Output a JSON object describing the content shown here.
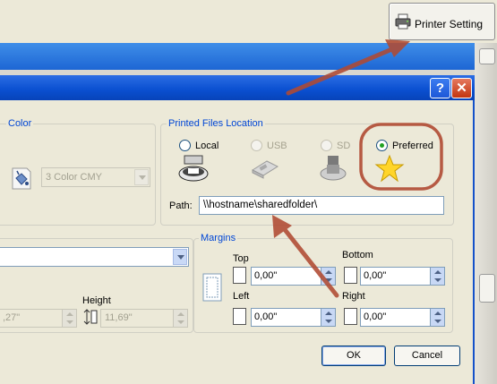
{
  "toolbar": {
    "printer_setting_label": "Printer Setting"
  },
  "dialog": {
    "help_button": "?",
    "close_button": "✕",
    "color_group": {
      "title": "Color",
      "select_value": "3 Color CMY"
    },
    "location_group": {
      "title": "Printed Files Location",
      "options": [
        {
          "label": "Local",
          "selected": false,
          "enabled": true
        },
        {
          "label": "USB",
          "selected": false,
          "enabled": false
        },
        {
          "label": "SD",
          "selected": false,
          "enabled": false
        },
        {
          "label": "Preferred",
          "selected": true,
          "enabled": true
        }
      ],
      "path_label": "Path:",
      "path_value": "\\\\hostname\\sharedfolder\\"
    },
    "size_group": {
      "height_label": "Height",
      "width_value": ",27\"",
      "height_value": "11,69\""
    },
    "margins_group": {
      "title": "Margins",
      "top_label": "Top",
      "top_value": "0,00\"",
      "bottom_label": "Bottom",
      "bottom_value": "0,00\"",
      "left_label": "Left",
      "left_value": "0,00\"",
      "right_label": "Right",
      "right_value": "0,00\""
    },
    "ok_label": "OK",
    "cancel_label": "Cancel"
  },
  "colors": {
    "annotation": "#b04a33",
    "titlebar": "#0a4fd0",
    "group_title": "#0046d5"
  }
}
